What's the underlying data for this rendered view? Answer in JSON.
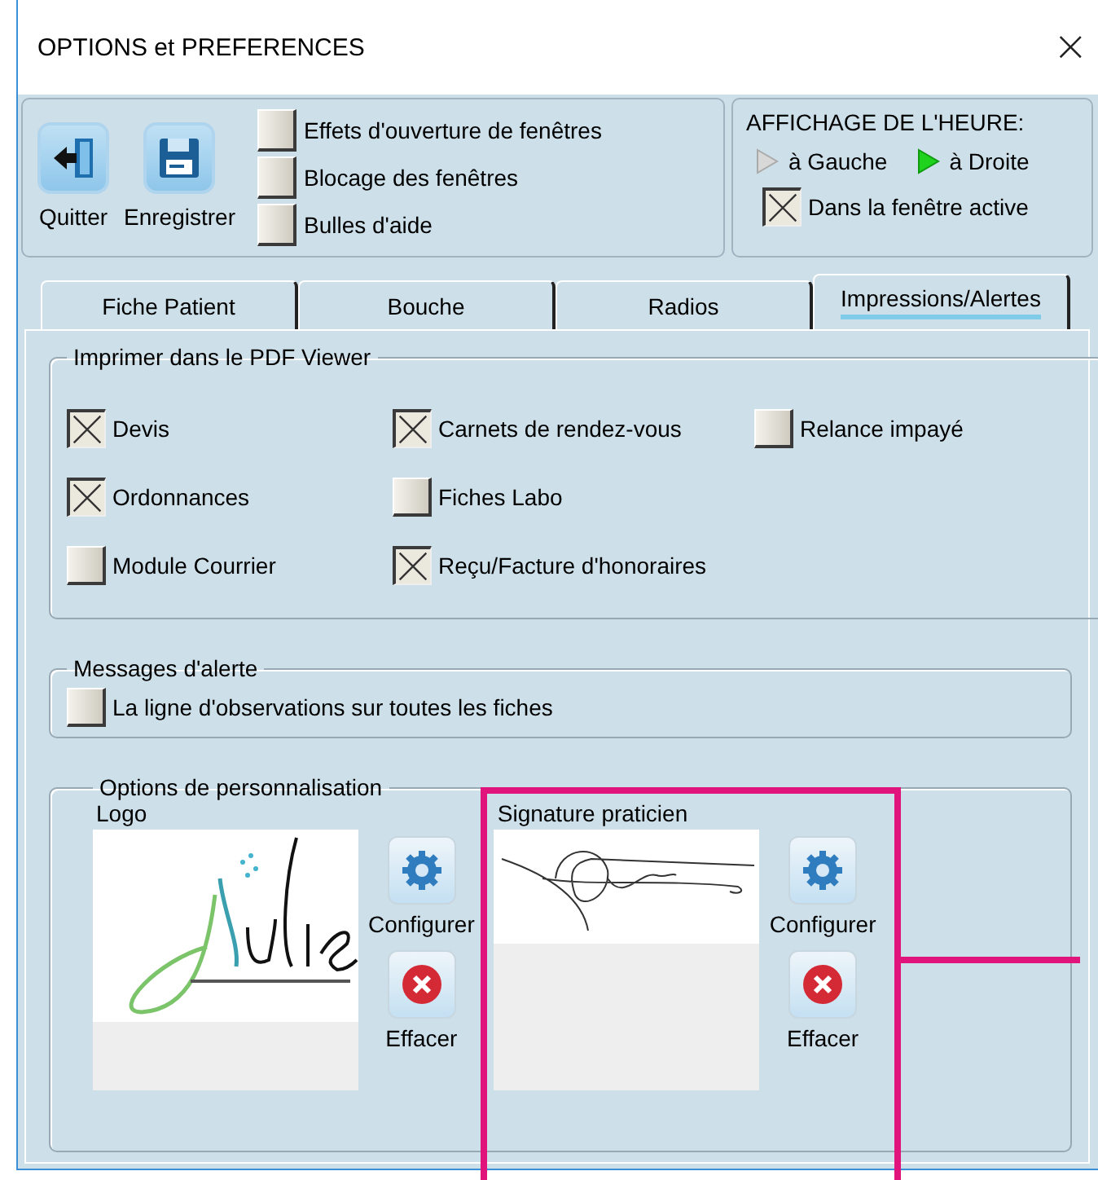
{
  "window": {
    "title": "OPTIONS et PREFERENCES",
    "close": "×"
  },
  "toolbar": {
    "buttons": [
      {
        "label": "Quitter",
        "kind": "exit"
      },
      {
        "label": "Enregistrer",
        "kind": "save"
      }
    ],
    "options": [
      {
        "label": "Effets d'ouverture de fenêtres",
        "checked": false
      },
      {
        "label": "Blocage des fenêtres",
        "checked": false
      },
      {
        "label": "Bulles d'aide",
        "checked": false
      }
    ]
  },
  "clock": {
    "title": "AFFICHAGE DE L'HEURE:",
    "positions": [
      {
        "label": "à Gauche",
        "selected": false
      },
      {
        "label": "à Droite",
        "selected": true
      }
    ],
    "active_window": {
      "label": "Dans la fenêtre active",
      "checked": true
    }
  },
  "tabs": [
    {
      "label": "Fiche Patient",
      "selected": false
    },
    {
      "label": "Bouche",
      "selected": false
    },
    {
      "label": "Radios",
      "selected": false
    },
    {
      "label": "Impressions/Alertes",
      "selected": true
    }
  ],
  "print_group": {
    "title": "Imprimer dans le PDF Viewer",
    "rows": [
      [
        {
          "label": "Devis",
          "checked": true
        },
        {
          "label": "Carnets de rendez-vous",
          "checked": true
        },
        {
          "label": "Relance impayé",
          "checked": false
        }
      ],
      [
        {
          "label": "Ordonnances",
          "checked": true
        },
        {
          "label": "Fiches Labo",
          "checked": false
        }
      ],
      [
        {
          "label": "Module Courrier",
          "checked": false
        },
        {
          "label": "Reçu/Facture d'honoraires",
          "checked": true
        }
      ]
    ]
  },
  "alerts_group": {
    "title": "Messages d'alerte",
    "items": [
      {
        "label": "La ligne d'observations sur toutes les fiches",
        "checked": false
      }
    ]
  },
  "personalization": {
    "title": "Options de personnalisation",
    "slots": [
      {
        "label": "Logo",
        "kind": "logo",
        "highlighted": false,
        "buttons": [
          {
            "label": "Configurer",
            "kind": "configure"
          },
          {
            "label": "Effacer",
            "kind": "clear"
          }
        ]
      },
      {
        "label": "Signature praticien",
        "kind": "signature",
        "highlighted": true,
        "buttons": [
          {
            "label": "Configurer",
            "kind": "configure"
          },
          {
            "label": "Effacer",
            "kind": "clear"
          }
        ]
      }
    ]
  }
}
